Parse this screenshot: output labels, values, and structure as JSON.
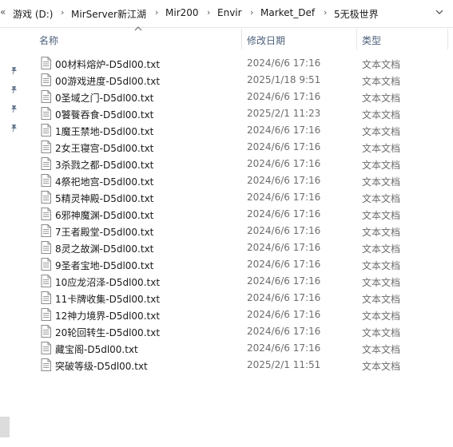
{
  "breadcrumb": {
    "overflow": "«",
    "items": [
      "游戏 (D:)",
      "MirServer新江湖",
      "Mir200",
      "Envir",
      "Market_Def",
      "5无极世界"
    ]
  },
  "columns": {
    "name": "名称",
    "date": "修改日期",
    "type": "类型"
  },
  "files": [
    {
      "name": "00材料熔炉-D5dl00.txt",
      "date": "2024/6/6 17:16",
      "type": "文本文档"
    },
    {
      "name": "00游戏进度-D5dl00.txt",
      "date": "2025/1/18 9:51",
      "type": "文本文档"
    },
    {
      "name": "0圣域之门-D5dl00.txt",
      "date": "2024/6/6 17:16",
      "type": "文本文档"
    },
    {
      "name": "0饕餮吞食-D5dl00.txt",
      "date": "2025/2/1 11:23",
      "type": "文本文档"
    },
    {
      "name": "1魔王禁地-D5dl00.txt",
      "date": "2024/6/6 17:16",
      "type": "文本文档"
    },
    {
      "name": "2女王寝宫-D5dl00.txt",
      "date": "2024/6/6 17:16",
      "type": "文本文档"
    },
    {
      "name": "3杀戮之都-D5dl00.txt",
      "date": "2024/6/6 17:16",
      "type": "文本文档"
    },
    {
      "name": "4祭祀地宫-D5dl00.txt",
      "date": "2024/6/6 17:16",
      "type": "文本文档"
    },
    {
      "name": "5精灵神殿-D5dl00.txt",
      "date": "2024/6/6 17:16",
      "type": "文本文档"
    },
    {
      "name": "6邪神魔渊-D5dl00.txt",
      "date": "2024/6/6 17:16",
      "type": "文本文档"
    },
    {
      "name": "7王者殿堂-D5dl00.txt",
      "date": "2024/6/6 17:16",
      "type": "文本文档"
    },
    {
      "name": "8灵之故渊-D5dl00.txt",
      "date": "2024/6/6 17:16",
      "type": "文本文档"
    },
    {
      "name": "9圣者宝地-D5dl00.txt",
      "date": "2024/6/6 17:16",
      "type": "文本文档"
    },
    {
      "name": "10应龙沼泽-D5dl00.txt",
      "date": "2024/6/6 17:16",
      "type": "文本文档"
    },
    {
      "name": "11卡牌收集-D5dl00.txt",
      "date": "2024/6/6 17:16",
      "type": "文本文档"
    },
    {
      "name": "12神力境界-D5dl00.txt",
      "date": "2024/6/6 17:16",
      "type": "文本文档"
    },
    {
      "name": "20轮回转生-D5dl00.txt",
      "date": "2024/6/6 17:16",
      "type": "文本文档"
    },
    {
      "name": "藏宝阁-D5dl00.txt",
      "date": "2024/6/6 17:16",
      "type": "文本文档"
    },
    {
      "name": "突破等级-D5dl00.txt",
      "date": "2025/2/1 11:51",
      "type": "文本文档"
    }
  ],
  "icons": {
    "file": "text-document-icon",
    "pin": "pin-icon",
    "dropdown": "chevron-down-icon",
    "sort": "sort-ascending-icon"
  },
  "colors": {
    "header_text": "#4c607a",
    "secondary_text": "#6d6d6d"
  }
}
